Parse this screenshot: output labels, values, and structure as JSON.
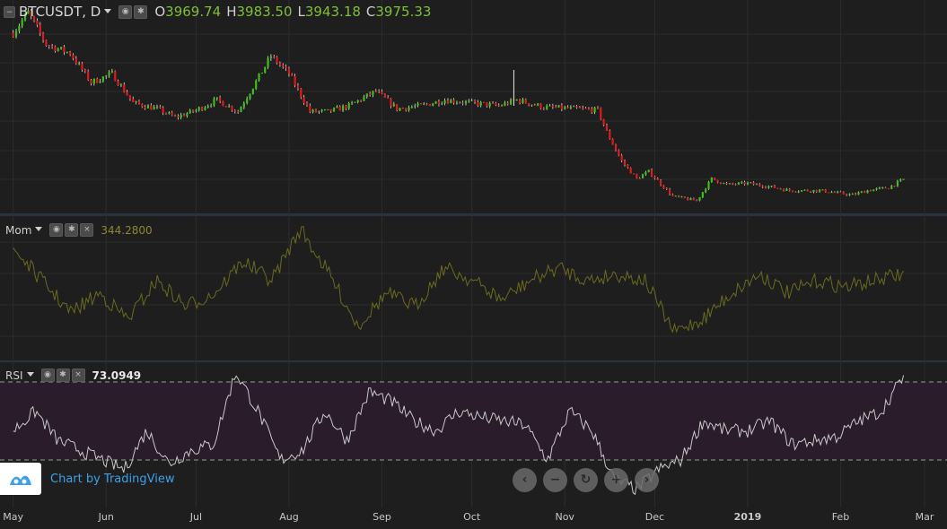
{
  "header": {
    "symbol": "BTCUSDT, D",
    "open_label": "O",
    "open": "3969.74",
    "high_label": "H",
    "high": "3983.50",
    "low_label": "L",
    "low": "3943.18",
    "close_label": "C",
    "close": "3975.33"
  },
  "indicators": {
    "mom": {
      "label": "Mom",
      "value": "344.2800"
    },
    "rsi": {
      "label": "RSI",
      "value": "73.0949"
    }
  },
  "branding": {
    "text": "Chart by TradingView"
  },
  "colors": {
    "up": "#39c212",
    "down": "#e01a1a",
    "mom_line": "#6b6a1e",
    "rsi_line": "#c8c8c8",
    "rsi_band": "#2a1c2a",
    "background": "#1e1e1e",
    "grid": "#2c2c2c"
  },
  "chart_data": [
    {
      "type": "candlestick",
      "symbol": "BTCUSDT",
      "interval": "D",
      "x_range": [
        "2018-05-01",
        "2019-02-22"
      ],
      "x_ticks": [
        "May",
        "Jun",
        "Jul",
        "Aug",
        "Sep",
        "Oct",
        "Nov",
        "Dec",
        "2019",
        "Feb",
        "Mar"
      ],
      "approx_close_path": {
        "x": [
          "2018-05-01",
          "2018-05-06",
          "2018-05-12",
          "2018-05-20",
          "2018-05-27",
          "2018-06-03",
          "2018-06-10",
          "2018-06-18",
          "2018-06-24",
          "2018-07-01",
          "2018-07-08",
          "2018-07-15",
          "2018-07-22",
          "2018-07-26",
          "2018-08-01",
          "2018-08-08",
          "2018-08-14",
          "2018-08-21",
          "2018-08-30",
          "2018-09-06",
          "2018-09-14",
          "2018-09-22",
          "2018-10-01",
          "2018-10-10",
          "2018-10-16",
          "2018-10-25",
          "2018-11-05",
          "2018-11-12",
          "2018-11-15",
          "2018-11-20",
          "2018-11-25",
          "2018-11-29",
          "2018-12-07",
          "2018-12-15",
          "2018-12-20",
          "2018-12-25",
          "2019-01-01",
          "2019-01-10",
          "2019-01-15",
          "2019-01-25",
          "2019-02-05",
          "2019-02-10",
          "2019-02-17",
          "2019-02-22"
        ],
        "y": [
          9000,
          9700,
          8600,
          8300,
          7300,
          7600,
          6600,
          6400,
          6100,
          6350,
          6700,
          6300,
          7500,
          8200,
          7600,
          6300,
          6300,
          6500,
          7000,
          6400,
          6500,
          6700,
          6600,
          6500,
          6700,
          6450,
          6400,
          6350,
          5600,
          4600,
          4000,
          4250,
          3400,
          3250,
          4000,
          3800,
          3850,
          3700,
          3600,
          3600,
          3450,
          3600,
          3700,
          3980
        ]
      }
    },
    {
      "type": "line",
      "name": "Mom",
      "last_value": 344.28,
      "approx_shape": [
        0.2,
        0.45,
        0.7,
        0.55,
        0.75,
        0.45,
        0.65,
        0.55,
        0.3,
        0.45,
        0.05,
        0.4,
        0.8,
        0.55,
        0.65,
        0.35,
        0.45,
        0.6,
        0.45,
        0.35,
        0.45,
        0.4,
        0.45,
        0.85,
        0.75,
        0.55,
        0.4,
        0.55,
        0.45,
        0.5,
        0.45,
        0.4
      ]
    },
    {
      "type": "line",
      "name": "RSI",
      "last_value": 73.0949,
      "bands": [
        70,
        30
      ],
      "approx_shape": [
        45,
        55,
        40,
        35,
        30,
        25,
        45,
        28,
        35,
        38,
        75,
        55,
        30,
        35,
        55,
        40,
        65,
        60,
        50,
        45,
        55,
        52,
        50,
        48,
        30,
        55,
        45,
        20,
        15,
        25,
        30,
        50,
        45,
        45,
        50,
        38,
        40,
        42,
        50,
        55,
        73
      ]
    }
  ]
}
